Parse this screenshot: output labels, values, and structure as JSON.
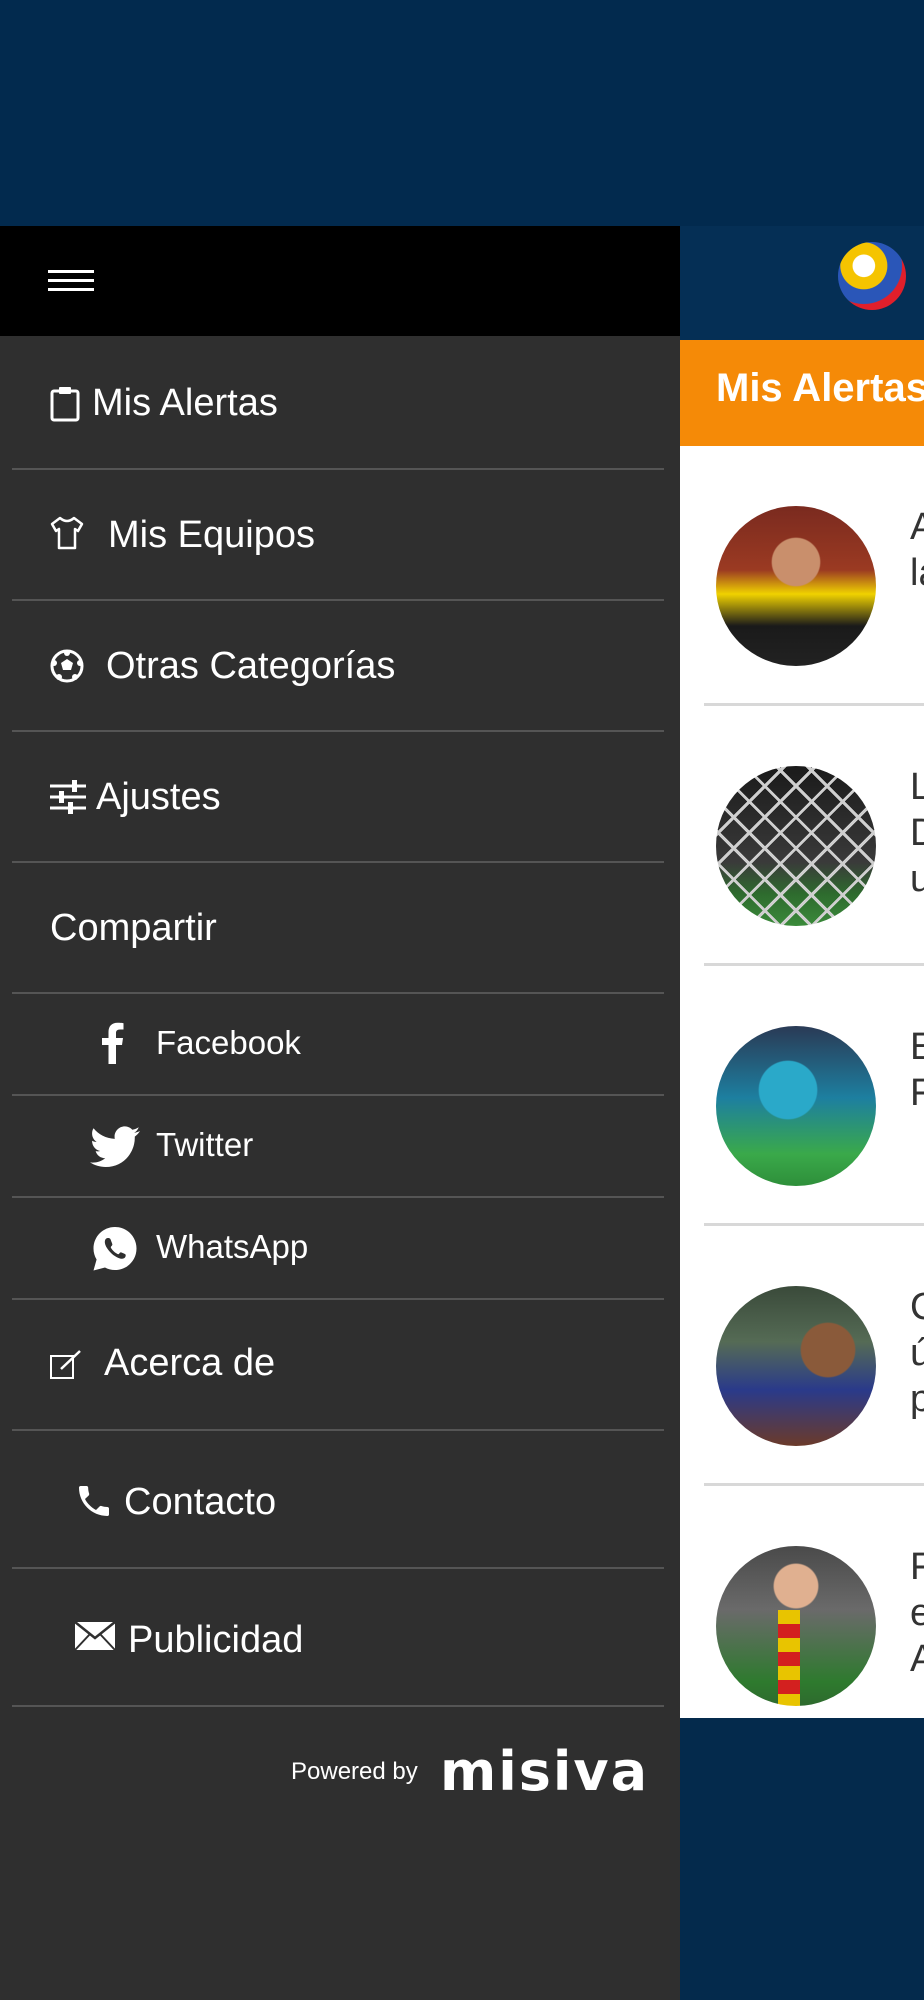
{
  "app": {
    "section_title": "Mis Alertas",
    "news": [
      {
        "snippet": "A\nla"
      },
      {
        "snippet": "L\nD\nu"
      },
      {
        "snippet": "E\nF"
      },
      {
        "snippet": "C\nú\np"
      },
      {
        "snippet": "F\ne\nA"
      }
    ]
  },
  "drawer": {
    "items": [
      {
        "label": "Mis Alertas",
        "icon": "clipboard-icon"
      },
      {
        "label": "Mis Equipos",
        "icon": "jersey-icon"
      },
      {
        "label": "Otras Categorías",
        "icon": "soccer-ball-icon"
      },
      {
        "label": "Ajustes",
        "icon": "sliders-icon"
      },
      {
        "label": "Compartir"
      },
      {
        "label": "Facebook",
        "icon": "facebook-icon"
      },
      {
        "label": "Twitter",
        "icon": "twitter-icon"
      },
      {
        "label": "WhatsApp",
        "icon": "whatsapp-icon"
      },
      {
        "label": "Acerca de",
        "icon": "edit-icon"
      },
      {
        "label": "Contacto",
        "icon": "phone-icon"
      },
      {
        "label": "Publicidad",
        "icon": "mail-icon"
      }
    ],
    "powered_by": "Powered by",
    "brand": "misiva"
  },
  "colors": {
    "drawer_bg": "#2f2f2f",
    "header_bg": "#000000",
    "accent_orange": "#f58a07",
    "app_blue": "#052f55"
  }
}
